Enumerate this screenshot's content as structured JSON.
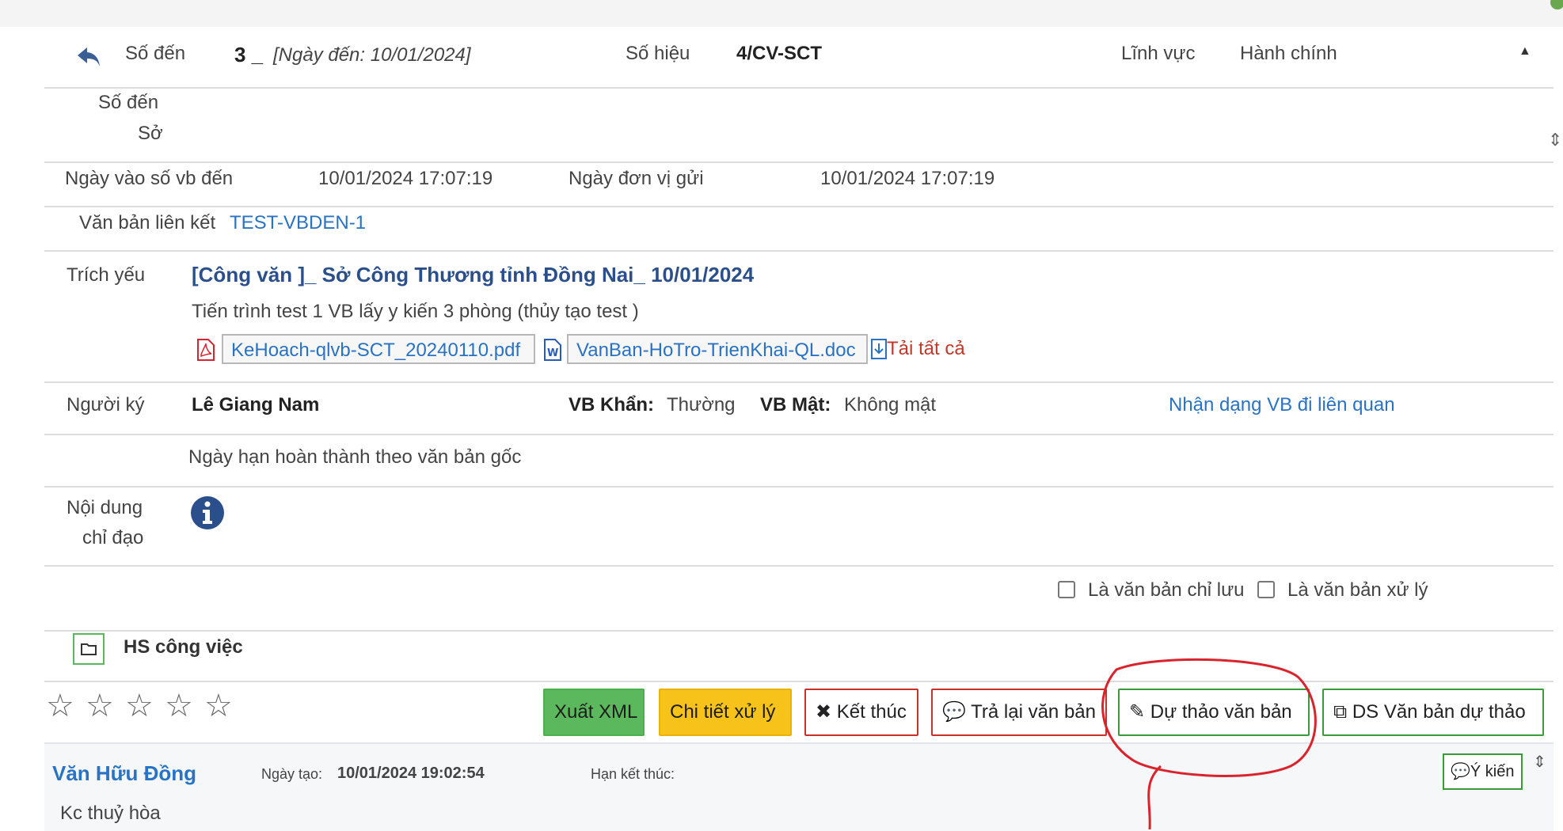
{
  "header": {
    "so_den_label": "Số đến",
    "so_den_value": "3 _",
    "ngay_den": "[Ngày đến: 10/01/2024]",
    "so_hieu_label": "Số hiệu",
    "so_hieu_value": "4/CV-SCT",
    "linh_vuc_label": "Lĩnh vực",
    "linh_vuc_value": "Hành chính"
  },
  "so_den_so": {
    "line1": "Số đến",
    "line2": "Sở"
  },
  "dates": {
    "ngay_vao_so_label": "Ngày vào số vb đến",
    "ngay_vao_so_value": "10/01/2024 17:07:19",
    "ngay_don_vi_gui_label": "Ngày đơn vị gửi",
    "ngay_don_vi_gui_value": "10/01/2024 17:07:19"
  },
  "lien_ket": {
    "label": "Văn bản liên kết",
    "link": "TEST-VBDEN-1"
  },
  "trich_yeu": {
    "label": "Trích yếu",
    "title": "[Công văn ]_ Sở Công Thương tỉnh Đồng Nai_ 10/01/2024",
    "description": "Tiến trình test 1 VB lấy y kiến 3 phòng (thủy tạo test )",
    "files": [
      "KeHoach-qlvb-SCT_20240110.pdf",
      "VanBan-HoTro-TrienKhai-QL.doc"
    ],
    "download_all": "Tải tất cả"
  },
  "nguoi_ky": {
    "label": "Người ký",
    "value": "Lê Giang Nam",
    "khan_label": "VB Khẩn:",
    "khan_value": "Thường",
    "mat_label": "VB Mật:",
    "mat_value": "Không mật",
    "related_link": "Nhận dạng VB đi liên quan"
  },
  "deadline": {
    "text": "Ngày hạn hoàn thành theo văn bản gốc"
  },
  "noi_dung": {
    "line1": "Nội dung",
    "line2": "chỉ đạo"
  },
  "checkboxes": {
    "chi_luu": "Là văn bản chỉ lưu",
    "xu_ly": "Là văn bản xử lý"
  },
  "hs_cong_viec": {
    "label": "HS công việc"
  },
  "rating": {
    "stars": 5,
    "filled": 0
  },
  "actions": {
    "xuat_xml": "Xuất XML",
    "chi_tiet": "Chi tiết xử lý",
    "ket_thuc": "Kết thúc",
    "tra_lai": "Trả lại văn bản",
    "du_thao": "Dự thảo văn bản",
    "ds_du_thao": "DS Văn bản dự thảo"
  },
  "comment": {
    "author": "Văn Hữu Đồng",
    "created_label": "Ngày tạo:",
    "created_value": "10/01/2024 19:02:54",
    "deadline_label": "Hạn kết thúc:",
    "content": "Kc thuỷ hòa",
    "opinion_button": "Ý kiến"
  },
  "colors": {
    "link_blue": "#2a72c2",
    "title_green": "#2e8b2e",
    "button_green": "#5cb85c",
    "button_yellow": "#f7c21a",
    "border_red": "#c9302c",
    "annotation_red": "#d9232d"
  }
}
